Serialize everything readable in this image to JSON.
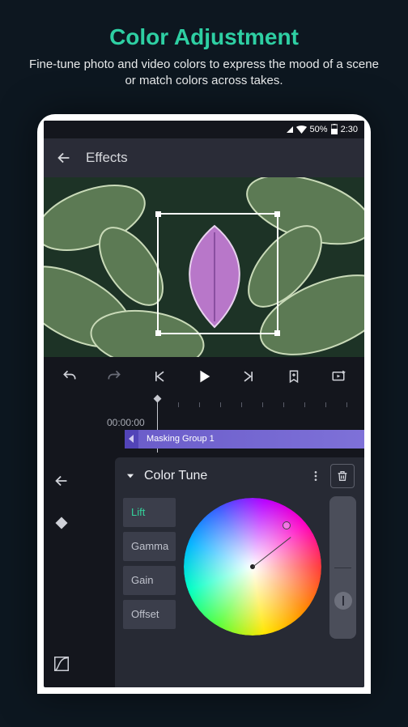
{
  "promo": {
    "title": "Color Adjustment",
    "subtitle": "Fine-tune photo and video colors to express the mood of a scene or match colors across takes."
  },
  "statusbar": {
    "battery": "50%",
    "time": "2:30"
  },
  "appbar": {
    "title": "Effects"
  },
  "timeline": {
    "timecode": "00:00:00",
    "clip_label": "Masking Group 1"
  },
  "panel": {
    "title": "Color Tune",
    "tabs": [
      {
        "label": "Lift",
        "active": true
      },
      {
        "label": "Gamma",
        "active": false
      },
      {
        "label": "Gain",
        "active": false
      },
      {
        "label": "Offset",
        "active": false
      }
    ]
  },
  "icons": {
    "back": "back-arrow",
    "undo": "undo",
    "redo": "redo",
    "prev": "skip-start",
    "play": "play",
    "next": "skip-end",
    "bookmark": "bookmark-add",
    "loop": "loop",
    "collapse": "arrow-left",
    "diamond": "keyframe",
    "curves": "curves",
    "caret": "caret-down",
    "more": "more-vert",
    "trash": "trash"
  }
}
